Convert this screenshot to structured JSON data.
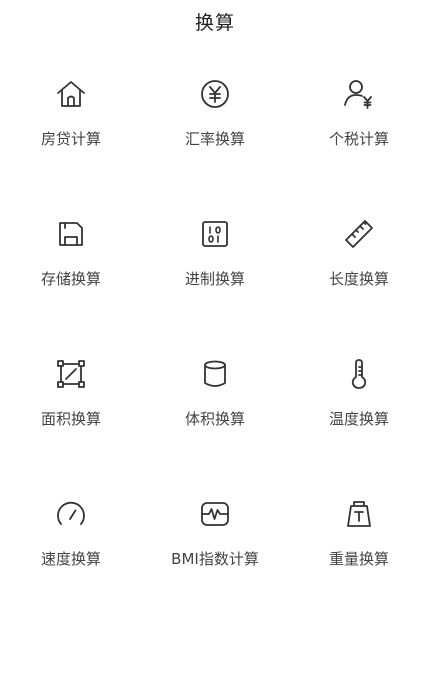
{
  "header": {
    "title": "换算"
  },
  "tools": [
    {
      "label": "房贷计算",
      "icon": "house-icon"
    },
    {
      "label": "汇率换算",
      "icon": "yen-coin-icon"
    },
    {
      "label": "个税计算",
      "icon": "person-yen-icon"
    },
    {
      "label": "存储换算",
      "icon": "floppy-disk-icon"
    },
    {
      "label": "进制换算",
      "icon": "binary-icon"
    },
    {
      "label": "长度换算",
      "icon": "ruler-icon"
    },
    {
      "label": "面积换算",
      "icon": "area-square-icon"
    },
    {
      "label": "体积换算",
      "icon": "cylinder-icon"
    },
    {
      "label": "温度换算",
      "icon": "thermometer-icon"
    },
    {
      "label": "速度换算",
      "icon": "speedometer-icon"
    },
    {
      "label": "BMI指数计算",
      "icon": "heartbeat-monitor-icon"
    },
    {
      "label": "重量换算",
      "icon": "weight-icon"
    }
  ]
}
